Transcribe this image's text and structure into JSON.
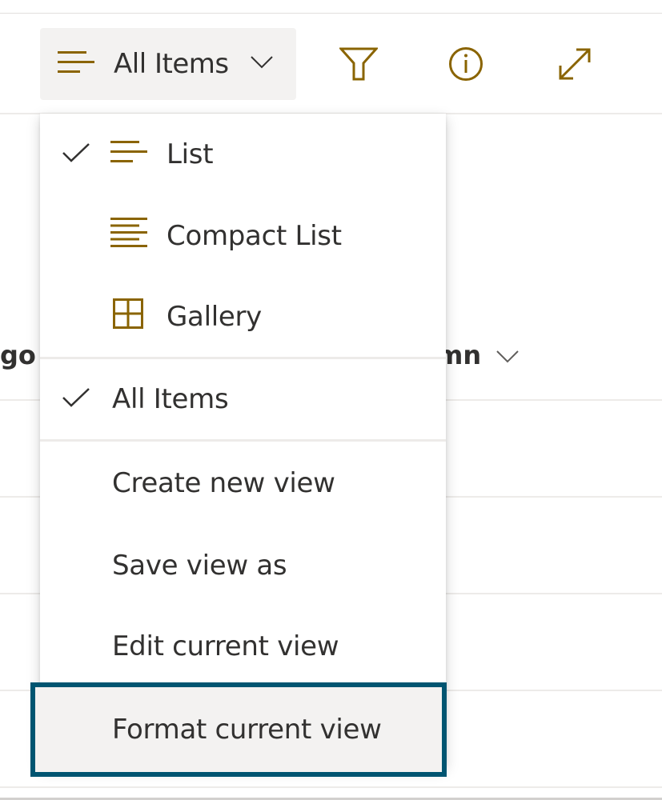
{
  "toolbar": {
    "view_switcher": {
      "label": "All Items",
      "icon": "list-lines-icon",
      "chevron": "chevron-down-icon"
    },
    "actions": [
      {
        "name": "filter",
        "icon": "filter-icon"
      },
      {
        "name": "info",
        "icon": "info-icon"
      },
      {
        "name": "expand",
        "icon": "expand-icon"
      }
    ]
  },
  "list": {
    "column_headers": [
      {
        "label": "go",
        "partial": true
      },
      {
        "label": "mn",
        "partial": true,
        "icon": "chevron-down-icon"
      }
    ]
  },
  "view_menu": {
    "layout_options": [
      {
        "label": "List",
        "icon": "list-icon",
        "checked": true
      },
      {
        "label": "Compact List",
        "icon": "compact-list-icon",
        "checked": false
      },
      {
        "label": "Gallery",
        "icon": "gallery-icon",
        "checked": false
      }
    ],
    "views": [
      {
        "label": "All Items",
        "checked": true
      }
    ],
    "actions": [
      {
        "label": "Create new view"
      },
      {
        "label": "Save view as"
      },
      {
        "label": "Edit current view"
      },
      {
        "label": "Format current view",
        "highlighted": true
      }
    ]
  },
  "colors": {
    "accent_icon": "#8a6400",
    "highlight_border": "#005571",
    "hover_bg": "#f3f2f1",
    "text": "#323130"
  }
}
